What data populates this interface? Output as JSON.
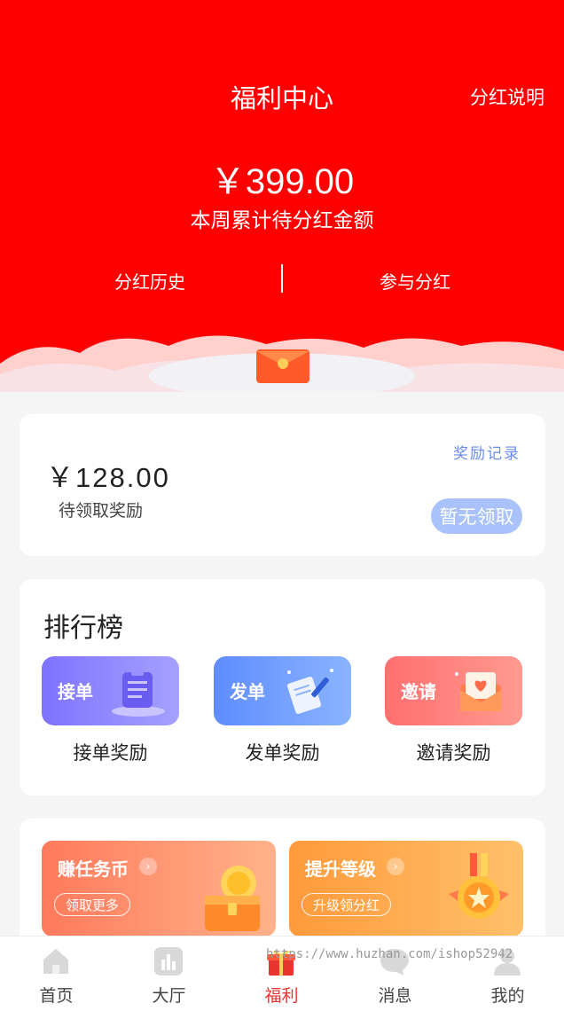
{
  "header": {
    "title": "福利中心",
    "rule_link": "分红说明",
    "amount": "￥399.00",
    "amount_label": "本周累计待分红金额",
    "history_link": "分红历史",
    "join_link": "参与分红",
    "accent": "#fe0000"
  },
  "reward_card": {
    "amount": "￥128.00",
    "label": "待领取奖励",
    "record_link": "奖励记录",
    "claim_button": "暂无领取"
  },
  "ranking": {
    "title": "排行榜",
    "tiles": [
      {
        "tag": "接单",
        "caption": "接单奖励",
        "icon": "clipboard-icon"
      },
      {
        "tag": "发单",
        "caption": "发单奖励",
        "icon": "document-pen-icon"
      },
      {
        "tag": "邀请",
        "caption": "邀请奖励",
        "icon": "heart-envelope-icon"
      }
    ]
  },
  "promos": [
    {
      "title": "赚任务币",
      "button": "领取更多",
      "icon": "treasure-chest-icon"
    },
    {
      "title": "提升等级",
      "button": "升级领分红",
      "icon": "medal-icon"
    }
  ],
  "tabbar": {
    "items": [
      {
        "label": "首页",
        "icon": "home-icon"
      },
      {
        "label": "大厅",
        "icon": "bar-chart-icon"
      },
      {
        "label": "福利",
        "icon": "gift-icon",
        "active": true
      },
      {
        "label": "消息",
        "icon": "message-icon"
      },
      {
        "label": "我的",
        "icon": "user-icon"
      }
    ],
    "active_color": "#e8352f"
  },
  "watermark": "https://www.huzhan.com/ishop52942"
}
